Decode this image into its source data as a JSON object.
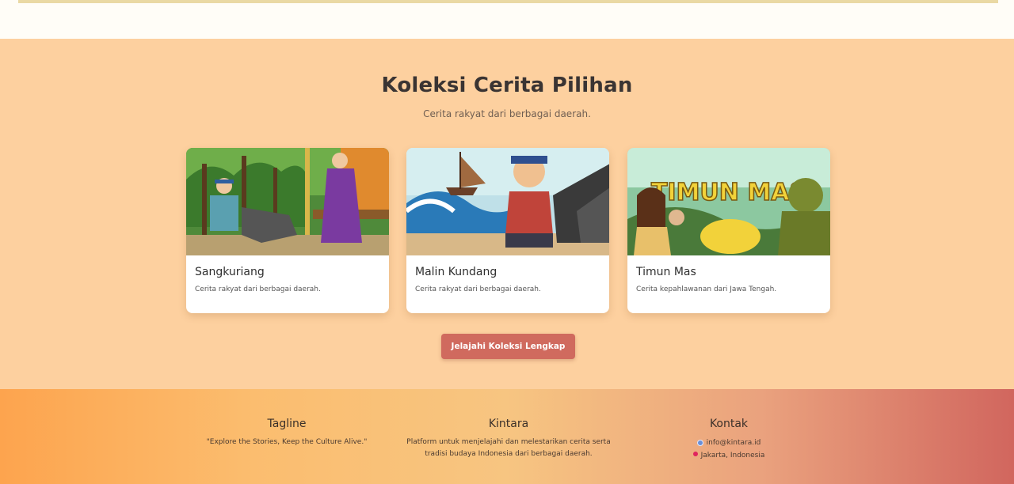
{
  "section": {
    "title": "Koleksi Cerita Pilihan",
    "subtitle": "Cerita rakyat dari berbagai daerah."
  },
  "cards": [
    {
      "title": "Sangkuriang",
      "description": "Cerita rakyat dari berbagai daerah."
    },
    {
      "title": "Malin Kundang",
      "description": "Cerita rakyat dari berbagai daerah."
    },
    {
      "title": "Timun Mas",
      "description": "Cerita kepahlawanan dari Jawa Tengah.",
      "image_text": "TIMUN MAS"
    }
  ],
  "cta": {
    "label": "Jelajahi Koleksi Lengkap"
  },
  "footer": {
    "tagline": {
      "heading": "Tagline",
      "text": "\"Explore the Stories, Keep the Culture Alive.\""
    },
    "about": {
      "heading": "Kintara",
      "text": "Platform untuk menjelajahi dan melestarikan cerita serta tradisi budaya Indonesia dari berbagai daerah."
    },
    "contact": {
      "heading": "Kontak",
      "email": "info@kintara.id",
      "location": "Jakarta, Indonesia"
    }
  },
  "colors": {
    "accent_button": "#d06a5e",
    "section_bg": "#fdd09f",
    "footer_gradient_start": "#fda44e",
    "footer_gradient_end": "#d1665e"
  },
  "icons": [
    "email-icon",
    "location-pin-icon"
  ]
}
